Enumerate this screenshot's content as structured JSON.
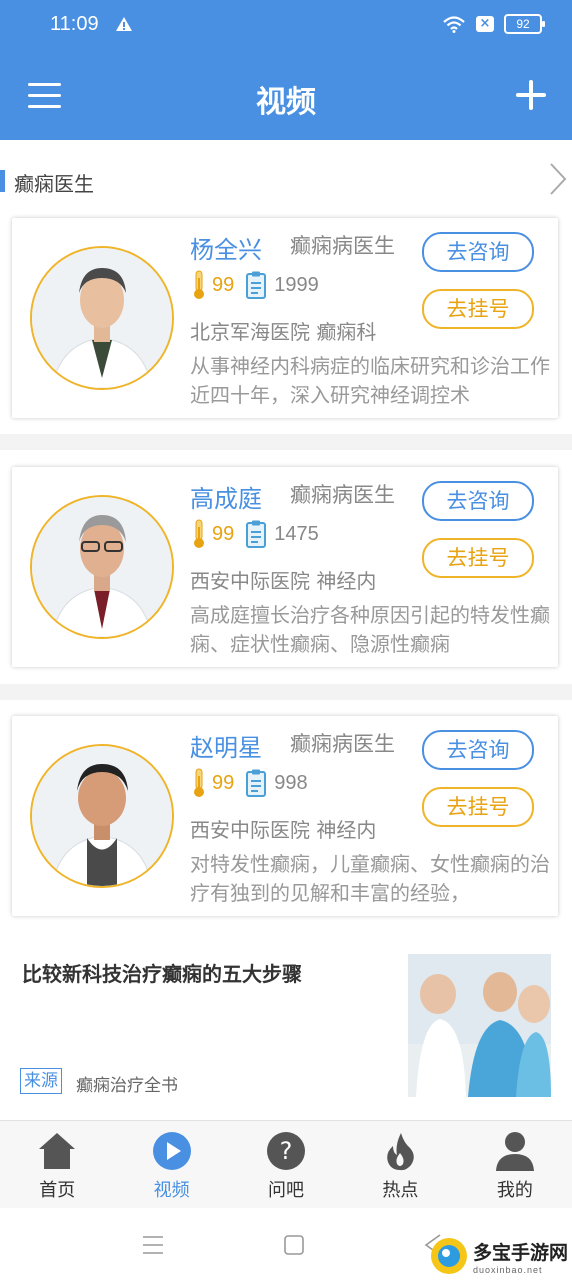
{
  "status_bar": {
    "time": "11:09",
    "battery": "92"
  },
  "app_bar": {
    "title": "视频"
  },
  "section": {
    "title": "癫痫医生"
  },
  "doctors": [
    {
      "name": "杨全兴",
      "title": "癫痫病医生",
      "heat": "99",
      "count": "1999",
      "hospital": "北京军海医院 癫痫科",
      "description": "从事神经内科病症的临床研究和诊治工作近四十年，深入研究神经调控术",
      "consult_label": "去咨询",
      "register_label": "去挂号"
    },
    {
      "name": "高成庭",
      "title": "癫痫病医生",
      "heat": "99",
      "count": "1475",
      "hospital": "西安中际医院 神经内",
      "description": "高成庭擅长治疗各种原因引起的特发性癫痫、症状性癫痫、隐源性癫痫",
      "consult_label": "去咨询",
      "register_label": "去挂号"
    },
    {
      "name": "赵明星",
      "title": "癫痫病医生",
      "heat": "99",
      "count": "998",
      "hospital": "西安中际医院 神经内",
      "description": "对特发性癫痫，儿童癫痫、女性癫痫的治疗有独到的见解和丰富的经验，",
      "consult_label": "去咨询",
      "register_label": "去挂号"
    }
  ],
  "article": {
    "title": "比较新科技治疗癫痫的五大步骤",
    "source_tag": "来源",
    "source_name": "癫痫治疗全书"
  },
  "tabs": [
    {
      "label": "首页",
      "icon": "home-icon"
    },
    {
      "label": "视频",
      "icon": "play-icon"
    },
    {
      "label": "问吧",
      "icon": "question-icon"
    },
    {
      "label": "热点",
      "icon": "flame-icon"
    },
    {
      "label": "我的",
      "icon": "person-icon"
    }
  ],
  "watermark": {
    "title": "多宝手游网",
    "subtitle": "duoxinbao.net"
  },
  "colors": {
    "primary": "#4a90e2",
    "accent": "#f0b429",
    "tab_icon": "#555555"
  }
}
